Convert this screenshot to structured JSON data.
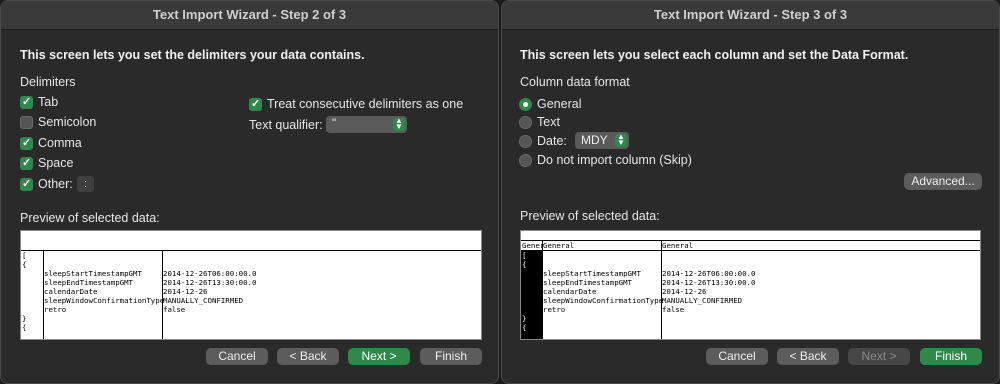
{
  "step2": {
    "title": "Text Import Wizard - Step 2 of 3",
    "intro": "This screen lets you set the delimiters your data contains.",
    "delimiters_heading": "Delimiters",
    "tab": "Tab",
    "semicolon": "Semicolon",
    "comma": "Comma",
    "space": "Space",
    "other": "Other:",
    "other_value": ":",
    "consecutive": "Treat consecutive delimiters as one",
    "qualifier_label": "Text qualifier:",
    "qualifier_value": "\"",
    "preview_heading": "Preview of selected data:",
    "preview_col1": [
      "[",
      "{",
      "",
      "",
      "",
      "",
      "",
      "}",
      "{"
    ],
    "preview_col2": [
      "",
      "",
      "sleepStartTimestampGMT",
      "sleepEndTimestampGMT",
      "calendarDate",
      "sleepWindowConfirmationType",
      "retro",
      "",
      ""
    ],
    "preview_col3": [
      "",
      "",
      "2014-12-26T06:00:00.0",
      "2014-12-26T13:30:00.0",
      "2014-12-26",
      "MANUALLY_CONFIRMED",
      "false",
      "",
      ""
    ],
    "buttons": {
      "cancel": "Cancel",
      "back": "< Back",
      "next": "Next >",
      "finish": "Finish"
    }
  },
  "step3": {
    "title": "Text Import Wizard - Step 3 of 3",
    "intro": "This screen lets you select each column and set the Data Format.",
    "format_heading": "Column data format",
    "general": "General",
    "text": "Text",
    "date": "Date:",
    "date_format": "MDY",
    "skip": "Do not import column (Skip)",
    "advanced": "Advanced...",
    "preview_heading": "Preview of selected data:",
    "col_headers": [
      "Gener",
      "General",
      "General"
    ],
    "preview_col1": [
      "[",
      "{",
      "",
      "",
      "",
      "",
      "",
      "}",
      "{"
    ],
    "preview_col2": [
      "",
      "",
      "sleepStartTimestampGMT",
      "sleepEndTimestampGMT",
      "calendarDate",
      "sleepWindowConfirmationType",
      "retro",
      "",
      ""
    ],
    "preview_col3": [
      "",
      "",
      "2014-12-26T06:00:00.0",
      "2014-12-26T13:30:00.0",
      "2014-12-26",
      "MANUALLY_CONFIRMED",
      "false",
      "",
      ""
    ],
    "buttons": {
      "cancel": "Cancel",
      "back": "< Back",
      "next": "Next >",
      "finish": "Finish"
    }
  },
  "colors": {
    "accent": "#2f8a4a",
    "window_bg": "#2a2a2a",
    "button_bg": "#5c5c5c"
  }
}
